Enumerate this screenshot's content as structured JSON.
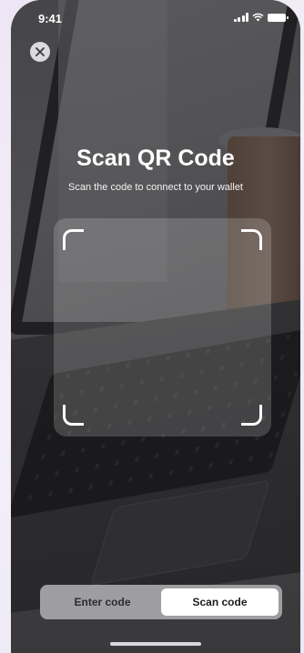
{
  "status_bar": {
    "time": "9:41"
  },
  "header": {
    "close_icon": "close-icon",
    "title": "Scan QR Code",
    "subtitle": "Scan the code to connect to your wallet"
  },
  "scanner": {
    "frame_icon": "qr-scan-frame"
  },
  "mode_toggle": {
    "options": [
      {
        "label": "Enter code",
        "selected": false
      },
      {
        "label": "Scan code",
        "selected": true
      }
    ]
  },
  "colors": {
    "overlay": "#3a3a3c",
    "accent": "#ffffff",
    "toggle_bg": "#9e9ea1"
  }
}
